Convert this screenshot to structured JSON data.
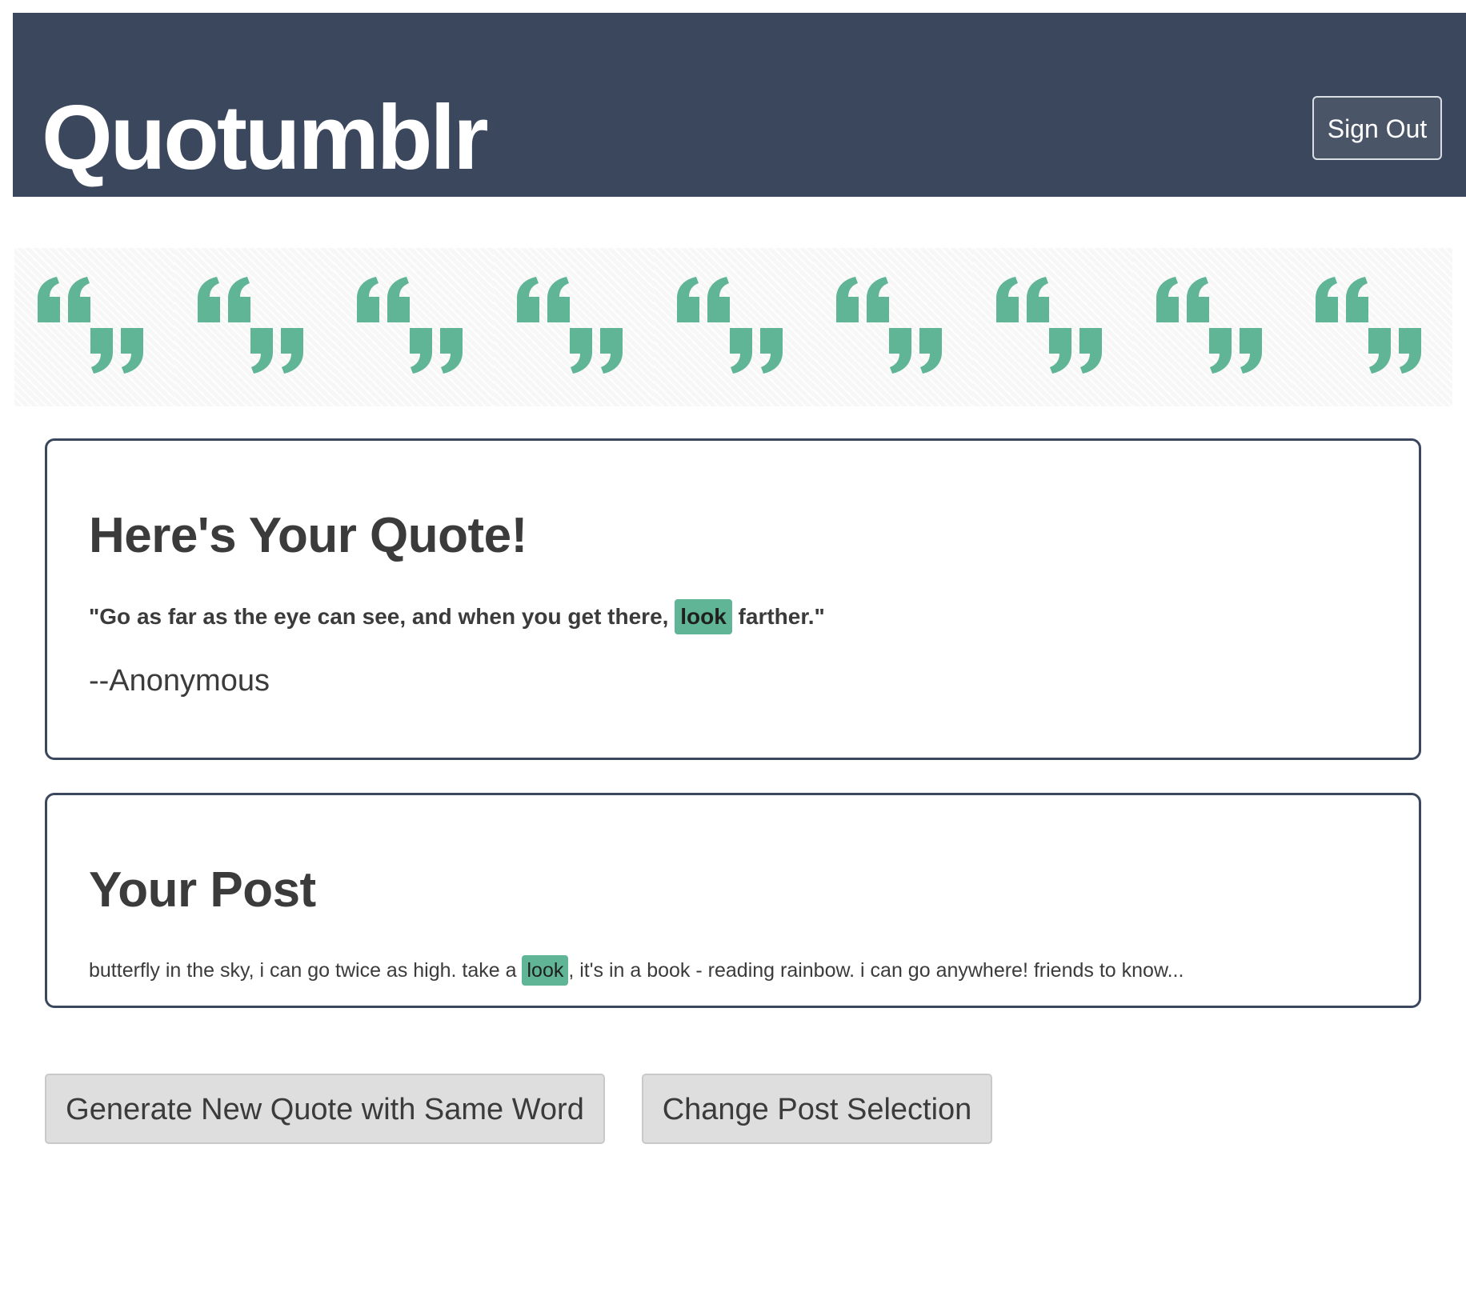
{
  "header": {
    "title": "Quotumblr",
    "sign_out_label": "Sign Out"
  },
  "banner": {
    "icon": "quote-marks-icon",
    "tile_count": 9,
    "accent_color": "#5fb595"
  },
  "quote_card": {
    "heading": "Here's Your Quote!",
    "text_before": "\"Go as far as the eye can see, and when you get there, ",
    "highlight_word": "look",
    "text_after": " farther.\"",
    "author": "--Anonymous"
  },
  "post_card": {
    "heading": "Your Post",
    "text_before": "butterfly in the sky, i can go twice as high. take a ",
    "highlight_word": "look",
    "text_after": ", it's in a book - reading rainbow. i can go anywhere! friends to know..."
  },
  "actions": {
    "generate_label": "Generate New Quote with Same Word",
    "change_label": "Change Post Selection"
  },
  "colors": {
    "header_bg": "#3b475d",
    "highlight": "#5fb595",
    "button_bg": "#dedede"
  }
}
